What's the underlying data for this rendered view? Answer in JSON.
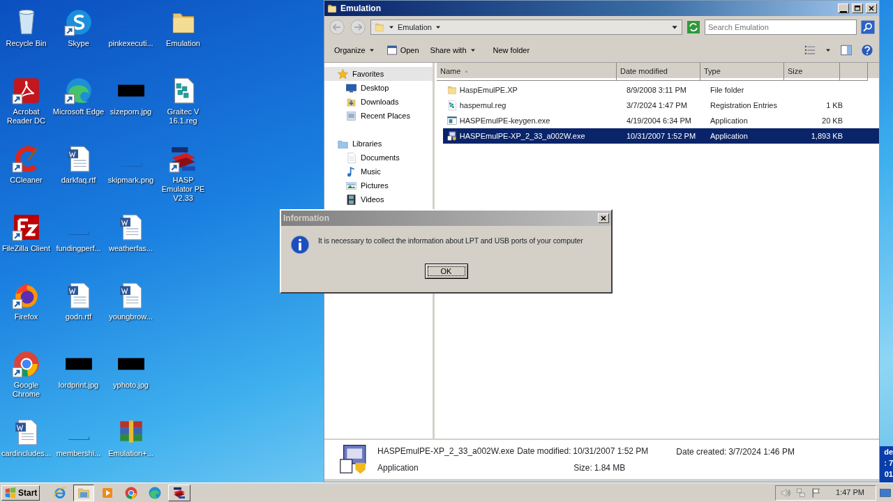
{
  "desktop_icons": [
    {
      "label": "Recycle Bin",
      "kind": "recycle",
      "shortcut": false
    },
    {
      "label": "Acrobat Reader DC",
      "kind": "acrobat",
      "shortcut": true
    },
    {
      "label": "CCleaner",
      "kind": "ccleaner",
      "shortcut": true
    },
    {
      "label": "FileZilla Client",
      "kind": "filezilla",
      "shortcut": true
    },
    {
      "label": "Firefox",
      "kind": "firefox",
      "shortcut": true
    },
    {
      "label": "Google Chrome",
      "kind": "chrome",
      "shortcut": true
    },
    {
      "label": "cardincludes...",
      "kind": "word",
      "shortcut": false
    },
    {
      "label": "Skype",
      "kind": "skype",
      "shortcut": true
    },
    {
      "label": "Microsoft Edge",
      "kind": "edge",
      "shortcut": true
    },
    {
      "label": "darkfaq.rtf",
      "kind": "word",
      "shortcut": false
    },
    {
      "label": "fundingperf...",
      "kind": "blank",
      "shortcut": false
    },
    {
      "label": "godn.rtf",
      "kind": "word",
      "shortcut": false
    },
    {
      "label": "lordprint.jpg",
      "kind": "redacted",
      "shortcut": false
    },
    {
      "label": "membershi...",
      "kind": "blank",
      "shortcut": false
    },
    {
      "label": "pinkexecuti...",
      "kind": "blank",
      "shortcut": false
    },
    {
      "label": "sizeporn.jpg",
      "kind": "redacted",
      "shortcut": false
    },
    {
      "label": "skipmark.png",
      "kind": "blank",
      "shortcut": false
    },
    {
      "label": "weatherfas...",
      "kind": "word",
      "shortcut": false
    },
    {
      "label": "youngbrow...",
      "kind": "word",
      "shortcut": false
    },
    {
      "label": "yphoto.jpg",
      "kind": "redacted",
      "shortcut": false
    },
    {
      "label": "Emulation+...",
      "kind": "winrar",
      "shortcut": false
    },
    {
      "label": "Emulation",
      "kind": "folder",
      "shortcut": false
    },
    {
      "label": "Graitec V 16.1.reg",
      "kind": "reg",
      "shortcut": false
    },
    {
      "label": "HASP Emulator PE V2.33",
      "kind": "hasp",
      "shortcut": true
    }
  ],
  "explorer": {
    "title": "Emulation",
    "active": true,
    "address": "Emulation",
    "search": {
      "placeholder": "Search Emulation"
    },
    "toolbar": [
      {
        "label": "Organize",
        "kind": "menu"
      },
      {
        "label": "Open",
        "kind": "open"
      },
      {
        "label": "Share with",
        "kind": "menu"
      },
      {
        "label": "New folder",
        "kind": "plain"
      }
    ],
    "nav_pane": [
      {
        "label": "Favorites",
        "kind": "star",
        "selected": true,
        "children": [
          {
            "label": "Desktop",
            "kind": "desktop",
            "selected": false
          },
          {
            "label": "Downloads",
            "kind": "downloads",
            "selected": false
          },
          {
            "label": "Recent Places",
            "kind": "recent",
            "selected": false
          }
        ]
      },
      {
        "label": "Libraries",
        "kind": "libraries",
        "selected": false,
        "children": [
          {
            "label": "Documents",
            "kind": "documents",
            "selected": false
          },
          {
            "label": "Music",
            "kind": "music",
            "selected": false
          },
          {
            "label": "Pictures",
            "kind": "pictures",
            "selected": false
          },
          {
            "label": "Videos",
            "kind": "videos",
            "selected": false
          }
        ]
      }
    ],
    "columns": [
      {
        "label": "Name",
        "sorted": true
      },
      {
        "label": "Date modified",
        "sorted": false
      },
      {
        "label": "Type",
        "sorted": false
      },
      {
        "label": "Size",
        "sorted": false
      }
    ],
    "files": [
      {
        "name": "HaspEmulPE.XP",
        "kind": "folder",
        "date": "8/9/2008 3:11 PM",
        "type": "File folder",
        "selected": false
      },
      {
        "name": "haspemul.reg",
        "kind": "reg",
        "date": "3/7/2024 1:47 PM",
        "type": "Registration Entries",
        "size": "1 KB",
        "selected": false
      },
      {
        "name": "HASPEmulPE-keygen.exe",
        "kind": "appwin",
        "date": "4/19/2004 6:34 PM",
        "type": "Application",
        "size": "20 KB",
        "selected": false
      },
      {
        "name": "HASPEmulPE-XP_2_33_a002W.exe",
        "kind": "setup",
        "date": "10/31/2007 1:52 PM",
        "type": "Application",
        "size": "1,893 KB",
        "selected": true
      }
    ],
    "details": {
      "name": "HASPEmulPE-XP_2_33_a002W.exe",
      "type": "Application",
      "fields": [
        {
          "label": "Date modified:",
          "value": "10/31/2007 1:52 PM"
        },
        {
          "label": "Size:",
          "value": "1.84 MB"
        },
        {
          "label": "Date created:",
          "value": "3/7/2024 1:46 PM"
        }
      ]
    }
  },
  "background_window_fragments": [
    "de",
    ": 7",
    "01"
  ],
  "dialog": {
    "title": "Information",
    "active": false,
    "message": "It is necessary to collect the information about LPT and USB ports of your computer",
    "button": "OK"
  },
  "taskbar": {
    "start": "Start",
    "items": [
      {
        "kind": "ie",
        "active": false
      },
      {
        "kind": "explorer",
        "active": true
      },
      {
        "kind": "media",
        "active": false
      },
      {
        "kind": "chrome",
        "active": false
      },
      {
        "kind": "edge",
        "active": false
      },
      {
        "kind": "hasp",
        "active": false
      }
    ],
    "time": "1:47 PM"
  }
}
